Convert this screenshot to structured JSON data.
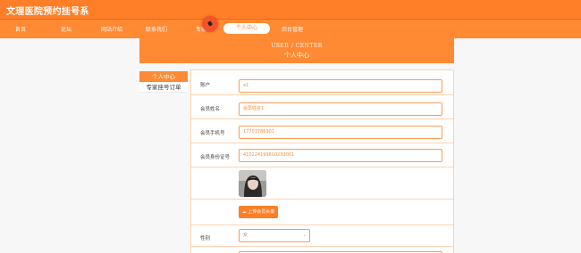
{
  "app": {
    "title": "文理医院预约挂号系"
  },
  "nav": {
    "items": [
      {
        "label": "首页"
      },
      {
        "label": "论坛"
      },
      {
        "label": "网站介绍"
      },
      {
        "label": "联系我们"
      },
      {
        "label": "专家"
      },
      {
        "label": "个人中心"
      },
      {
        "label": "后台管理"
      }
    ]
  },
  "banner": {
    "title_en": "USER / CENTER",
    "title_zh": "个人中心"
  },
  "sidebar": {
    "items": [
      {
        "label": "个人中心"
      },
      {
        "label": "专家挂号订单"
      }
    ]
  },
  "form": {
    "account": {
      "label": "账户",
      "value": "a1"
    },
    "name": {
      "label": "会员姓名",
      "value": "会员姓名1"
    },
    "phone": {
      "label": "会员手机号",
      "value": "17703786901"
    },
    "idcard": {
      "label": "会员身份证号",
      "value": "410224199610232001"
    },
    "upload_button": "上传会员头像",
    "gender": {
      "label": "性别",
      "value": "女"
    }
  },
  "colors": {
    "accent": "#ff7f29",
    "nav_bg": "#ff8a33",
    "border": "#ffd2b0"
  },
  "icons": {
    "upload": "upload-icon",
    "select": "chevron-down-icon"
  }
}
